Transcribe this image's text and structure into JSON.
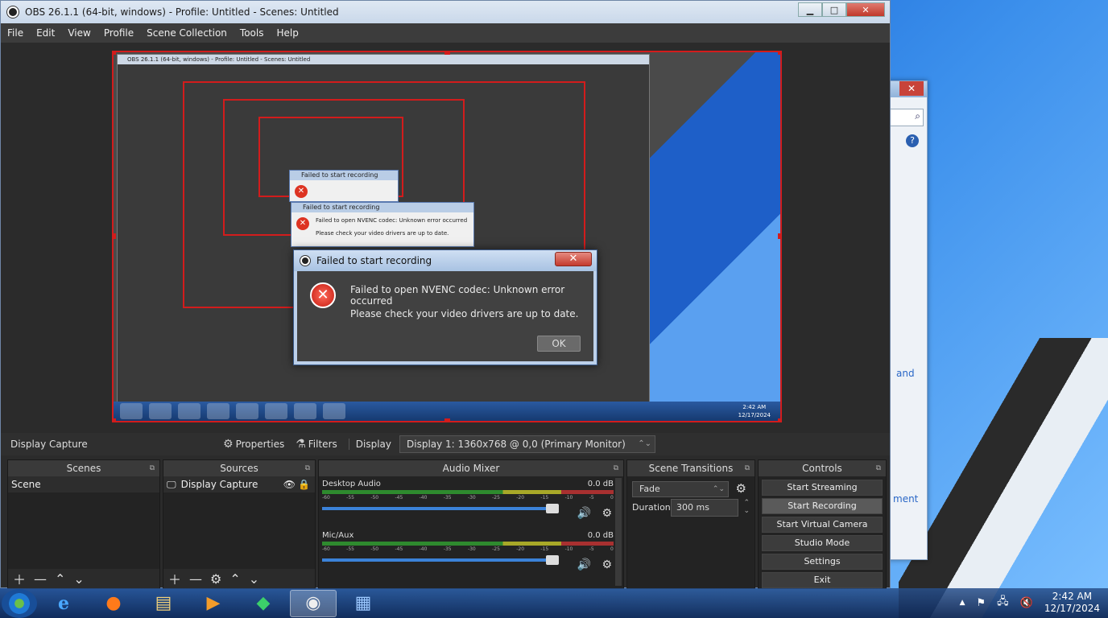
{
  "window": {
    "title": "OBS 26.1.1 (64-bit, windows) - Profile: Untitled - Scenes: Untitled",
    "min": "▁",
    "max": "□",
    "close": "✕"
  },
  "menu": [
    "File",
    "Edit",
    "View",
    "Profile",
    "Scene Collection",
    "Tools",
    "Help"
  ],
  "dialog": {
    "title": "Failed to start recording",
    "close": "✕",
    "line1": "Failed to open NVENC codec: Unknown error occurred",
    "line2": "Please check your video drivers are up to date.",
    "ok": "OK"
  },
  "source_toolbar": {
    "name": "Display Capture",
    "properties": "Properties",
    "filters": "Filters",
    "display_label": "Display",
    "display_value": "Display 1: 1360x768 @ 0,0 (Primary Monitor)"
  },
  "scenes": {
    "title": "Scenes",
    "items": [
      "Scene"
    ]
  },
  "sources": {
    "title": "Sources",
    "items": [
      "Display Capture"
    ]
  },
  "mixer": {
    "title": "Audio Mixer",
    "channels": [
      {
        "name": "Desktop Audio",
        "level": "0.0 dB"
      },
      {
        "name": "Mic/Aux",
        "level": "0.0 dB"
      }
    ],
    "scale": [
      "-60",
      "-55",
      "-50",
      "-45",
      "-40",
      "-35",
      "-30",
      "-25",
      "-20",
      "-15",
      "-10",
      "-5",
      "0"
    ]
  },
  "transitions": {
    "title": "Scene Transitions",
    "type": "Fade",
    "duration_label": "Duration",
    "duration": "300 ms"
  },
  "controls": {
    "title": "Controls",
    "buttons": [
      "Start Streaming",
      "Start Recording",
      "Start Virtual Camera",
      "Studio Mode",
      "Settings",
      "Exit"
    ]
  },
  "bg_window": {
    "link1": "and",
    "link2": "ment",
    "close": "✕"
  },
  "taskbar": {
    "time": "2:42 AM",
    "date": "12/17/2024"
  },
  "inner": {
    "time": "2:42 AM",
    "date": "12/17/2024",
    "title": "OBS 26.1.1 (64-bit, windows) - Profile: Untitled - Scenes: Untitled",
    "dialog_title": "Failed to start recording",
    "dialog_line1": "Failed to open NVENC codec: Unknown error occurred",
    "dialog_line2": "Please check your video drivers are up to date."
  }
}
